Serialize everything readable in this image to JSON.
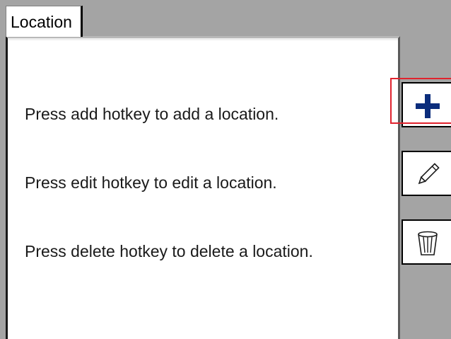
{
  "tabs": [
    {
      "label": "Location",
      "active": true
    }
  ],
  "instructions": {
    "add": "Press add hotkey to add a location.",
    "edit": "Press edit hotkey to edit a location.",
    "delete": "Press delete hotkey to delete a location."
  },
  "hotkeys": [
    {
      "action": "add",
      "icon": "plus-icon",
      "focused": true
    },
    {
      "action": "edit",
      "icon": "pencil-icon",
      "focused": false
    },
    {
      "action": "delete",
      "icon": "trash-icon",
      "focused": false
    }
  ],
  "colors": {
    "background": "#a4a4a4",
    "panel": "#ffffff",
    "focus_outline": "#e0232e",
    "add_icon": "#0b2d7c"
  }
}
